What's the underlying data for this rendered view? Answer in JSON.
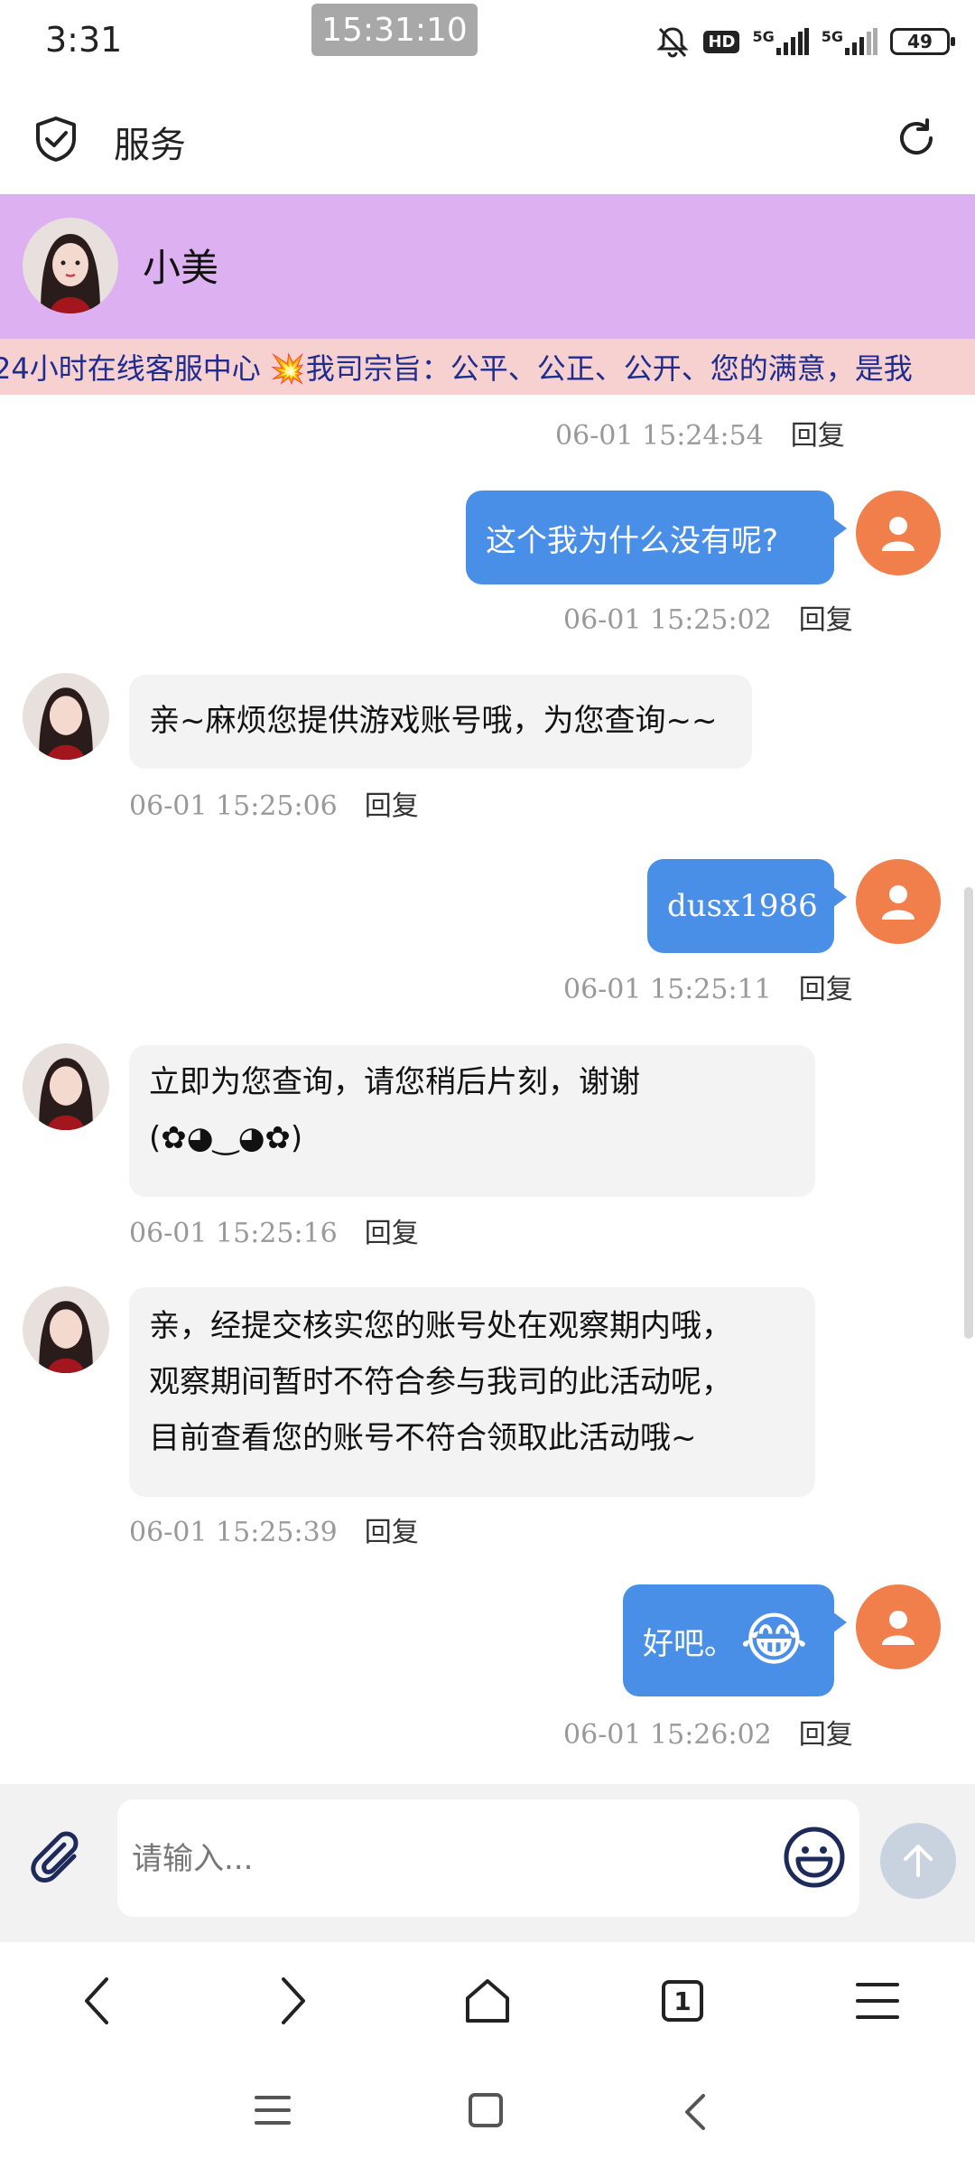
{
  "status_bar": {
    "time": "3:31",
    "clock_overlay": "15:31:10",
    "network_1": "5G",
    "network_2": "5G",
    "battery": "49",
    "hd_label": "HD"
  },
  "app_bar": {
    "title": "服务"
  },
  "chat_header": {
    "agent_name": "小美"
  },
  "marquee": {
    "text": "24小时在线客服中心 💥我司宗旨：公平、公正、公开、您的满意，是我"
  },
  "reply_label": "回复",
  "messages": [
    {
      "from": "agent",
      "time": "06-01 15:24:54"
    },
    {
      "from": "me",
      "text": "这个我为什么没有呢?",
      "time": "06-01 15:25:02"
    },
    {
      "from": "agent",
      "text": "亲~麻烦您提供游戏账号哦，为您查询~~",
      "time": "06-01 15:25:06"
    },
    {
      "from": "me",
      "text": "dusx1986",
      "time": "06-01 15:25:11"
    },
    {
      "from": "agent",
      "text_line1": "立即为您查询，请您稍后片刻，谢谢",
      "text_line2": "(✿◕‿◕✿)",
      "time": "06-01 15:25:16"
    },
    {
      "from": "agent",
      "text_line1": "亲，经提交核实您的账号处在观察期内哦，",
      "text_line2": "观察期间暂时不符合参与我司的此活动呢，",
      "text_line3": "目前查看您的账号不符合领取此活动哦~",
      "time": "06-01 15:25:39"
    },
    {
      "from": "me",
      "text": "好吧。",
      "emoji": "😂",
      "time": "06-01 15:26:02"
    }
  ],
  "composer": {
    "placeholder": "请输入..."
  },
  "browser_nav": {
    "tab_count": "1"
  },
  "colors": {
    "header_bg": "#ddb0f2",
    "marquee_bg": "#f7d0d0",
    "outgoing_bubble": "#4a8fe7",
    "incoming_bubble": "#f3f3f3",
    "my_avatar": "#f07f4c"
  }
}
